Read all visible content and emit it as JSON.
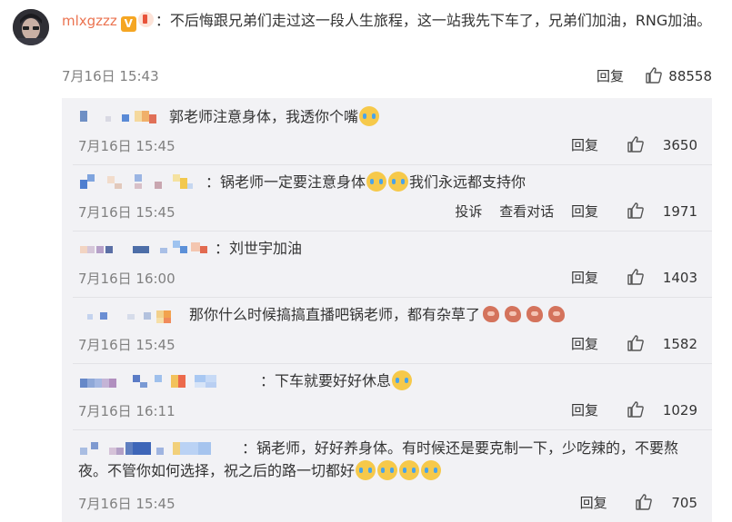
{
  "comment": {
    "username": "mlxgzzz",
    "text": "：不后悔跟兄弟们走过这一段人生旅程，这一站我先下车了，兄弟们加油，RNG加油。",
    "time": "7月16日 15:43",
    "reply_label": "回复",
    "likes": "88558"
  },
  "replies": [
    {
      "text": "郭老师注意身体，我透你个嘴",
      "time": "7月16日 15:45",
      "reply_label": "回复",
      "likes": "3650"
    },
    {
      "text": "：锅老师一定要注意身体",
      "text2": "我们永远都支持你",
      "time": "7月16日 15:45",
      "report_label": "投诉",
      "thread_label": "查看对话",
      "reply_label": "回复",
      "likes": "1971"
    },
    {
      "text": "：刘世宇加油",
      "time": "7月16日 16:00",
      "reply_label": "回复",
      "likes": "1403"
    },
    {
      "text": "那你什么时候搞搞直播吧锅老师，都有杂草了",
      "time": "7月16日 15:45",
      "reply_label": "回复",
      "likes": "1582"
    },
    {
      "text": "：下车就要好好休息",
      "time": "7月16日 16:11",
      "reply_label": "回复",
      "likes": "1029"
    },
    {
      "text": "：锅老师，好好养身体。有时候还是要克制一下，少吃辣的，不要熬夜。不管你如何选择，祝之后的路一切都好",
      "time": "7月16日 15:45",
      "reply_label": "回复",
      "likes": "705"
    }
  ],
  "icons": {
    "verified": "verified-badge-icon",
    "member": "member-badge-icon",
    "like": "thumbs-up-icon",
    "cry": "crying-emoji-icon",
    "pig": "pig-emoji-icon"
  }
}
